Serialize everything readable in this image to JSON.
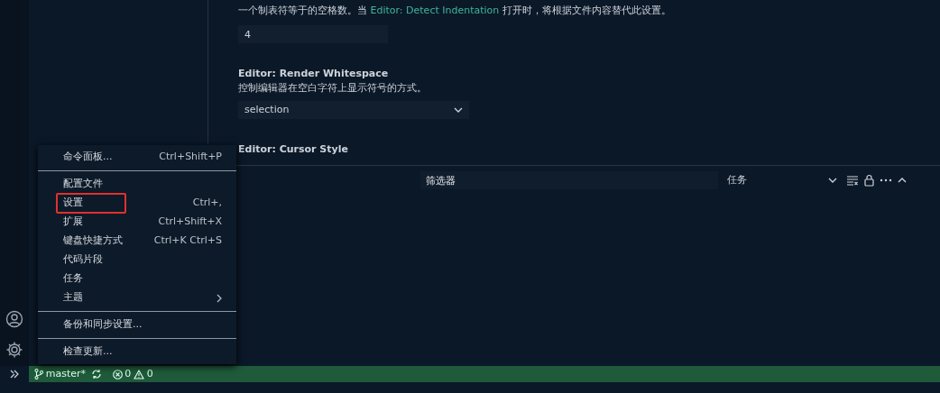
{
  "settings": [
    {
      "kind": "input",
      "description_before": "一个制表符等于的空格数。当 ",
      "description_link": "Editor: Detect Indentation",
      "description_after": " 打开时，将根据文件内容替代此设置。",
      "value": "4"
    },
    {
      "kind": "select",
      "title": "Editor: Render Whitespace",
      "description": "控制编辑器在空白字符上显示符号的方式。",
      "value": "selection"
    },
    {
      "kind": "heading",
      "title": "Editor: Cursor Style"
    }
  ],
  "panel": {
    "filter": {
      "placeholder": "筛选器"
    },
    "task_select": {
      "value": "任务"
    }
  },
  "menu": [
    [
      {
        "label": "命令面板...",
        "shortcut": "Ctrl+Shift+P",
        "submenu": false,
        "highlighted": false
      }
    ],
    [
      {
        "label": "配置文件",
        "submenu": false,
        "highlighted": false
      },
      {
        "label": "设置",
        "shortcut": "Ctrl+,",
        "submenu": false,
        "highlighted": true
      },
      {
        "label": "扩展",
        "shortcut": "Ctrl+Shift+X",
        "submenu": false,
        "highlighted": false
      },
      {
        "label": "键盘快捷方式",
        "shortcut": "Ctrl+K Ctrl+S",
        "submenu": false,
        "highlighted": false
      },
      {
        "label": "代码片段",
        "submenu": false,
        "highlighted": false
      },
      {
        "label": "任务",
        "submenu": false,
        "highlighted": false
      },
      {
        "label": "主题",
        "submenu": true,
        "highlighted": false
      }
    ],
    [
      {
        "label": "备份和同步设置...",
        "submenu": false,
        "highlighted": false
      }
    ],
    [
      {
        "label": "检查更新...",
        "submenu": false,
        "highlighted": false
      }
    ]
  ],
  "status_bar": {
    "branch": "master*",
    "errors": "0",
    "warnings": "0"
  }
}
